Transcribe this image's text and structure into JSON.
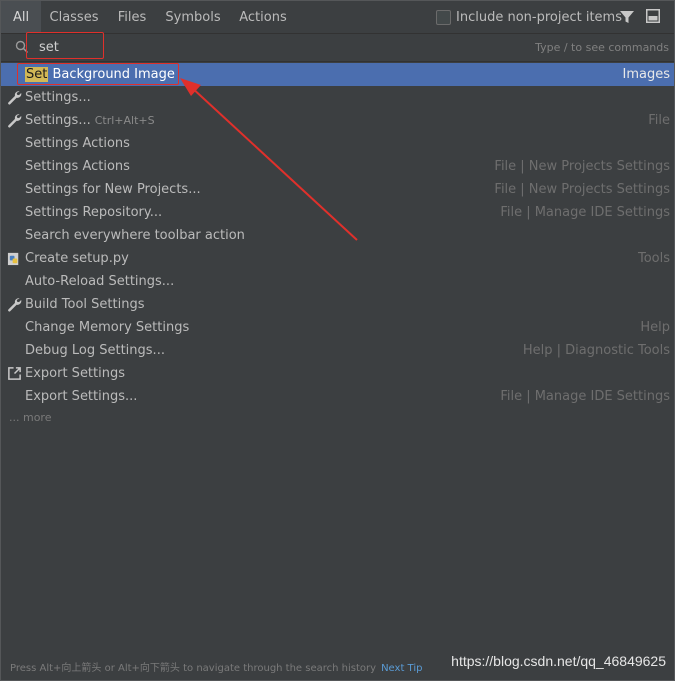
{
  "tabs": [
    {
      "label": "All"
    },
    {
      "label": "Classes"
    },
    {
      "label": "Files"
    },
    {
      "label": "Symbols"
    },
    {
      "label": "Actions"
    }
  ],
  "include_non_project": {
    "label": "Include non-project items",
    "checked": false
  },
  "icons": {
    "filter": "filter-icon",
    "preview": "preview-toggle-icon",
    "search": "search-icon"
  },
  "search": {
    "value": "set",
    "hint": "Type / to see commands"
  },
  "results": [
    {
      "match": "Set",
      "rest": " Background Image",
      "shortcut": "",
      "location": "Images",
      "icon": "",
      "selected": true
    },
    {
      "match": "",
      "rest": "Settings...",
      "shortcut": "",
      "location": "",
      "icon": "wrench-icon",
      "selected": false
    },
    {
      "match": "",
      "rest": "Settings...",
      "shortcut": "Ctrl+Alt+S",
      "location": "File",
      "icon": "wrench-icon",
      "selected": false
    },
    {
      "match": "",
      "rest": "Settings Actions",
      "shortcut": "",
      "location": "",
      "icon": "",
      "selected": false
    },
    {
      "match": "",
      "rest": "Settings Actions",
      "shortcut": "",
      "location": "File | New Projects Settings",
      "icon": "",
      "selected": false
    },
    {
      "match": "",
      "rest": "Settings for New Projects...",
      "shortcut": "",
      "location": "File | New Projects Settings",
      "icon": "",
      "selected": false
    },
    {
      "match": "",
      "rest": "Settings Repository...",
      "shortcut": "",
      "location": "File | Manage IDE Settings",
      "icon": "",
      "selected": false
    },
    {
      "match": "",
      "rest": "Search everywhere toolbar action",
      "shortcut": "",
      "location": "",
      "icon": "",
      "selected": false
    },
    {
      "match": "",
      "rest": "Create setup.py",
      "shortcut": "",
      "location": "Tools",
      "icon": "python-icon",
      "selected": false
    },
    {
      "match": "",
      "rest": "Auto-Reload Settings...",
      "shortcut": "",
      "location": "",
      "icon": "",
      "selected": false
    },
    {
      "match": "",
      "rest": "Build Tool Settings",
      "shortcut": "",
      "location": "",
      "icon": "wrench-icon",
      "selected": false
    },
    {
      "match": "",
      "rest": "Change Memory Settings",
      "shortcut": "",
      "location": "Help",
      "icon": "",
      "selected": false
    },
    {
      "match": "",
      "rest": "Debug Log Settings...",
      "shortcut": "",
      "location": "Help | Diagnostic Tools",
      "icon": "",
      "selected": false
    },
    {
      "match": "",
      "rest": "Export Settings",
      "shortcut": "",
      "location": "",
      "icon": "export-icon",
      "selected": false
    },
    {
      "match": "",
      "rest": "Export Settings...",
      "shortcut": "",
      "location": "File | Manage IDE Settings",
      "icon": "",
      "selected": false
    }
  ],
  "more_label": "... more",
  "footer": {
    "tip": "Press Alt+向上箭头 or Alt+向下箭头 to navigate through the search history",
    "next_tip": "Next Tip"
  },
  "watermark": "https://blog.csdn.net/qq_46849625",
  "colors": {
    "background": "#3c3f41",
    "selection": "#4b6eaf",
    "match_highlight": "#d2b856",
    "annotation": "#e0302b",
    "link": "#5a9bd5"
  }
}
